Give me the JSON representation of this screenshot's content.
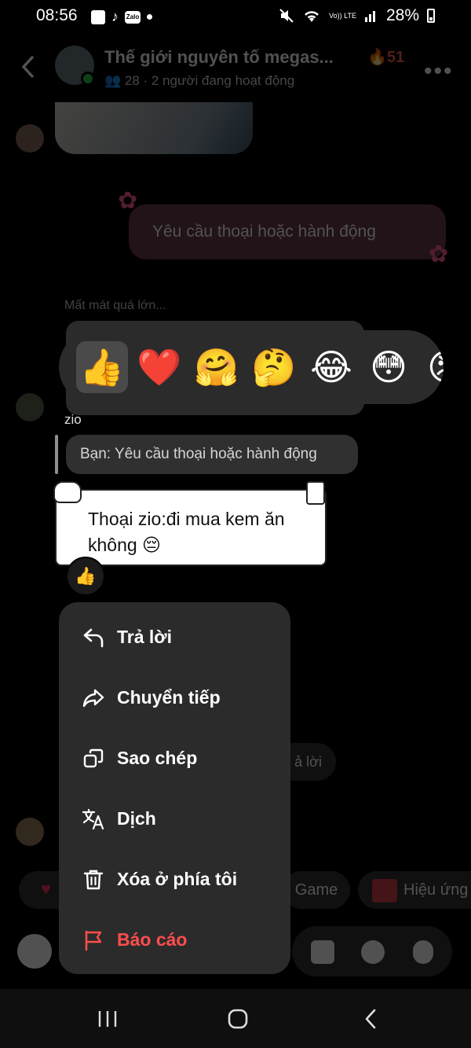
{
  "status_bar": {
    "time": "08:56",
    "notif_zalo": "Zalo",
    "battery": "28%",
    "volte": "Vo)) LTE"
  },
  "header": {
    "title": "Thế giới nguyên tố megas...",
    "streak": "51",
    "members": "28 · 2 người đang hoạt động"
  },
  "background": {
    "sent_message": "Yêu cầu thoại hoặc hành động",
    "reply_hint": "Mất mát quá lớn...",
    "reply_chip": "ả lời",
    "game_chip": "Game",
    "effect_chip": "Hiệu ứng"
  },
  "focused_message": {
    "sender": "zio",
    "quote": "Bạn: Yêu cầu thoại hoặc hành động",
    "text": "Thoại zio:đi mua kem ăn không 😔",
    "reaction": "👍"
  },
  "reactions": [
    "👍",
    "❤️",
    "🤗",
    "🤔",
    "😂",
    "😳",
    "😡"
  ],
  "menu": [
    {
      "label": "Trả lời",
      "icon": "reply-icon",
      "color": "#ffffff"
    },
    {
      "label": "Chuyển tiếp",
      "icon": "forward-icon",
      "color": "#ffffff"
    },
    {
      "label": "Sao chép",
      "icon": "copy-icon",
      "color": "#ffffff"
    },
    {
      "label": "Dịch",
      "icon": "translate-icon",
      "color": "#ffffff"
    },
    {
      "label": "Xóa ở phía tôi",
      "icon": "trash-icon",
      "color": "#ffffff"
    },
    {
      "label": "Báo cáo",
      "icon": "flag-icon",
      "color": "#ff4d4d"
    }
  ]
}
